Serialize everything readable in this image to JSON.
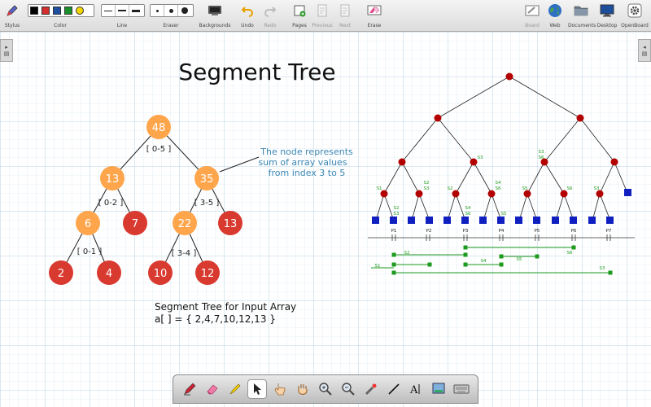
{
  "toolbar": {
    "stylus_label": "Stylus",
    "color_label": "Color",
    "line_label": "Line",
    "eraser_label": "Eraser",
    "backgrounds_label": "Backgrounds",
    "undo_label": "Undo",
    "redo_label": "Redo",
    "pages_label": "Pages",
    "previous_label": "Previous",
    "next_label": "Next",
    "erase_label": "Erase",
    "board_label": "Board",
    "web_label": "Web",
    "documents_label": "Documents",
    "desktop_label": "Desktop",
    "openboard_label": "OpenBoard",
    "colors": [
      "#000000",
      "#d32f2f",
      "#1e4fa0",
      "#1a8f2a",
      "#f5d600"
    ]
  },
  "board": {
    "title": "Segment Tree",
    "annotation": [
      "The node represents",
      "sum of array values",
      "from index 3 to 5"
    ],
    "caption_line1": "Segment Tree for Input Array",
    "caption_line2": "a[ ] = { 2,4,7,10,12,13 }",
    "tree_nodes": [
      {
        "id": "n48",
        "value": "48",
        "kind": "internal"
      },
      {
        "id": "n13a",
        "value": "13",
        "kind": "internal"
      },
      {
        "id": "n35",
        "value": "35",
        "kind": "internal"
      },
      {
        "id": "n6",
        "value": "6",
        "kind": "internal"
      },
      {
        "id": "n7",
        "value": "7",
        "kind": "leaf"
      },
      {
        "id": "n22",
        "value": "22",
        "kind": "internal"
      },
      {
        "id": "n13b",
        "value": "13",
        "kind": "leaf"
      },
      {
        "id": "n2",
        "value": "2",
        "kind": "leaf"
      },
      {
        "id": "n4",
        "value": "4",
        "kind": "leaf"
      },
      {
        "id": "n10",
        "value": "10",
        "kind": "leaf"
      },
      {
        "id": "n12",
        "value": "12",
        "kind": "leaf"
      }
    ],
    "ranges": [
      "[ 0-5 ]",
      "[ 0-2 ]",
      "[ 3-5 ]",
      "[ 0-1 ]",
      "[ 3-4 ]"
    ],
    "diagram_labels": {
      "s1": "S1",
      "s2": "S2",
      "s3": "S3",
      "s4": "S4",
      "s5": "S5",
      "s6": "S6",
      "p1": "P1",
      "p2": "P2",
      "p3": "P3",
      "p4": "P4",
      "p5": "P5",
      "p6": "P6",
      "p7": "P7"
    },
    "colors": {
      "internal_node": "#ffa64d",
      "leaf_node": "#d93a30",
      "annotation": "#3a86b4",
      "diagram_node": "#b30000",
      "diagram_leaf": "#1020c0",
      "segment": "#1e9a1e"
    }
  },
  "dock": {
    "tools": [
      "pen-icon",
      "eraser-icon",
      "highlighter-icon",
      "pointer-icon",
      "hand-pointer-icon",
      "hand-icon",
      "zoom-in-icon",
      "zoom-out-icon",
      "laser-icon",
      "line-icon",
      "text-icon",
      "capture-icon",
      "keyboard-icon"
    ]
  }
}
